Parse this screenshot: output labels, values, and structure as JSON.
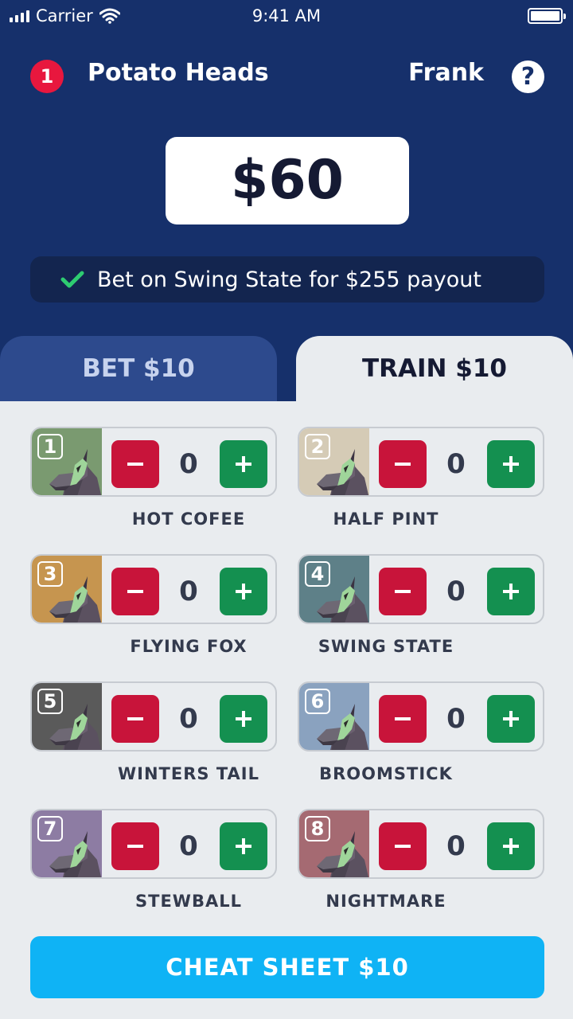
{
  "status": {
    "carrier": "Carrier",
    "time": "9:41 AM"
  },
  "header": {
    "team_number": "1",
    "team_name": "Potato Heads",
    "player": "Frank",
    "help": "?"
  },
  "balance": "$60",
  "hint": "Bet on Swing State for $255 payout",
  "tabs": [
    {
      "label": "BET $10",
      "active": false
    },
    {
      "label": "TRAIN $10",
      "active": true
    }
  ],
  "horses": [
    {
      "number": "1",
      "name": "HOT COFEE",
      "count": "0",
      "color": "#7a9a70"
    },
    {
      "number": "2",
      "name": "HALF PINT",
      "count": "0",
      "color": "#d5cbb6"
    },
    {
      "number": "3",
      "name": "FLYING FOX",
      "count": "0",
      "color": "#c6954f"
    },
    {
      "number": "4",
      "name": "SWING STATE",
      "count": "0",
      "color": "#5e8088"
    },
    {
      "number": "5",
      "name": "WINTERS TAIL",
      "count": "0",
      "color": "#5a5a5a"
    },
    {
      "number": "6",
      "name": "BROOMSTICK",
      "count": "0",
      "color": "#8aa2bf"
    },
    {
      "number": "7",
      "name": "STEWBALL",
      "count": "0",
      "color": "#8d7ca3"
    },
    {
      "number": "8",
      "name": "NIGHTMARE",
      "count": "0",
      "color": "#a56a72"
    }
  ],
  "cheat_sheet": "CHEAT SHEET $10",
  "colors": {
    "header_bg": "#16306b",
    "minus": "#c8143a",
    "plus": "#149050",
    "cta": "#0fb3f5",
    "badge": "#e8173e"
  }
}
